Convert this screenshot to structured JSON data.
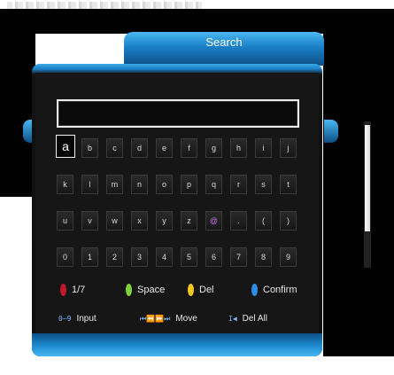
{
  "window": {
    "title": "Search"
  },
  "search": {
    "value": ""
  },
  "keyboard": {
    "selected": "a",
    "rows": [
      [
        "a",
        "b",
        "c",
        "d",
        "e",
        "f",
        "g",
        "h",
        "i",
        "j"
      ],
      [
        "k",
        "l",
        "m",
        "n",
        "o",
        "p",
        "q",
        "r",
        "s",
        "t"
      ],
      [
        "u",
        "v",
        "w",
        "x",
        "y",
        "z",
        "@",
        ".",
        "(",
        ")"
      ],
      [
        "0",
        "1",
        "2",
        "3",
        "4",
        "5",
        "6",
        "7",
        "8",
        "9"
      ]
    ]
  },
  "legend": {
    "red": {
      "label": "1/7",
      "color": "#c0182a"
    },
    "green": {
      "label": "Space",
      "color": "#7fd23a"
    },
    "yellow": {
      "label": "Del",
      "color": "#f0c820"
    },
    "blue": {
      "label": "Confirm",
      "color": "#2a8fe6"
    },
    "input": {
      "keys": "0~9",
      "label": "Input"
    },
    "move": {
      "keys": "⏮⏪⏩⏭",
      "label": "Move"
    },
    "delall": {
      "keys": "I◀",
      "label": "Del All"
    }
  },
  "colors": {
    "accent": "#1a7fc6",
    "panel": "#161616",
    "key_text": "#d8d8d8",
    "highlight_text": "#d070f0"
  }
}
